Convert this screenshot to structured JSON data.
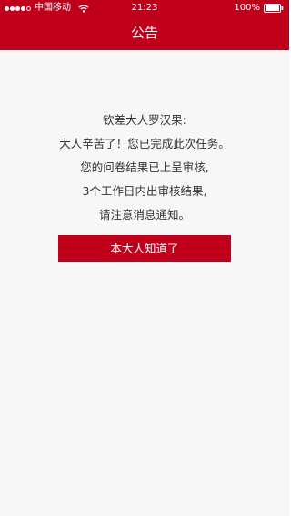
{
  "status_bar": {
    "carrier": "中国移动",
    "time": "21:23",
    "battery_percent": "100%",
    "signal_bars_filled": 4,
    "signal_bars_total": 5
  },
  "nav": {
    "title": "公告"
  },
  "message": {
    "lines": [
      "钦差大人罗汉果:",
      "大人辛苦了！您已完成此次任务。",
      "您的问卷结果已上呈审核,",
      "3个工作日内出审核结果,",
      "请注意消息通知。"
    ]
  },
  "confirm_button": {
    "label": "本大人知道了"
  },
  "colors": {
    "accent": "#c0001a",
    "background": "#f7f7f7",
    "text": "#333333"
  },
  "icons": {
    "wifi": "wifi-icon",
    "battery": "battery-icon",
    "signal": "signal-icon"
  }
}
